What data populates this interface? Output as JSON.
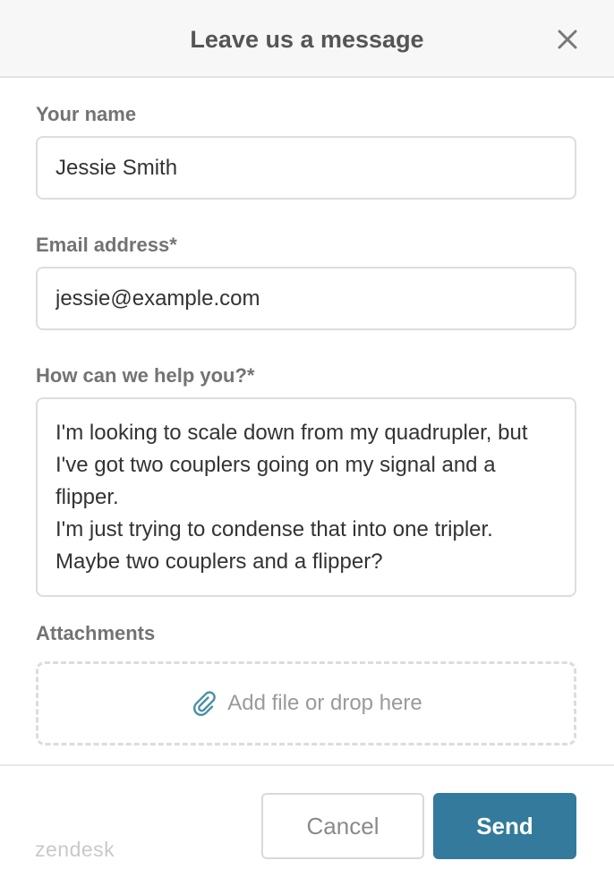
{
  "header": {
    "title": "Leave us a message",
    "close_icon": "close-icon"
  },
  "form": {
    "name": {
      "label": "Your name",
      "value": "Jessie Smith"
    },
    "email": {
      "label": "Email address*",
      "value": "jessie@example.com"
    },
    "message": {
      "label": "How can we help you?*",
      "value": "I'm looking to scale down from my quadrupler, but I've got two couplers going on my signal and a flipper.\nI'm just trying to condense that into one tripler. Maybe two couplers and a flipper?"
    },
    "attachments": {
      "label": "Attachments",
      "dropzone_text": "Add file or drop here",
      "icon": "paperclip-icon"
    }
  },
  "footer": {
    "logo_text": "zendesk",
    "cancel_label": "Cancel",
    "send_label": "Send"
  },
  "colors": {
    "accent": "#337a9c",
    "paperclip": "#4a90a4",
    "label": "#737373",
    "header_bg": "#f7f7f7"
  }
}
